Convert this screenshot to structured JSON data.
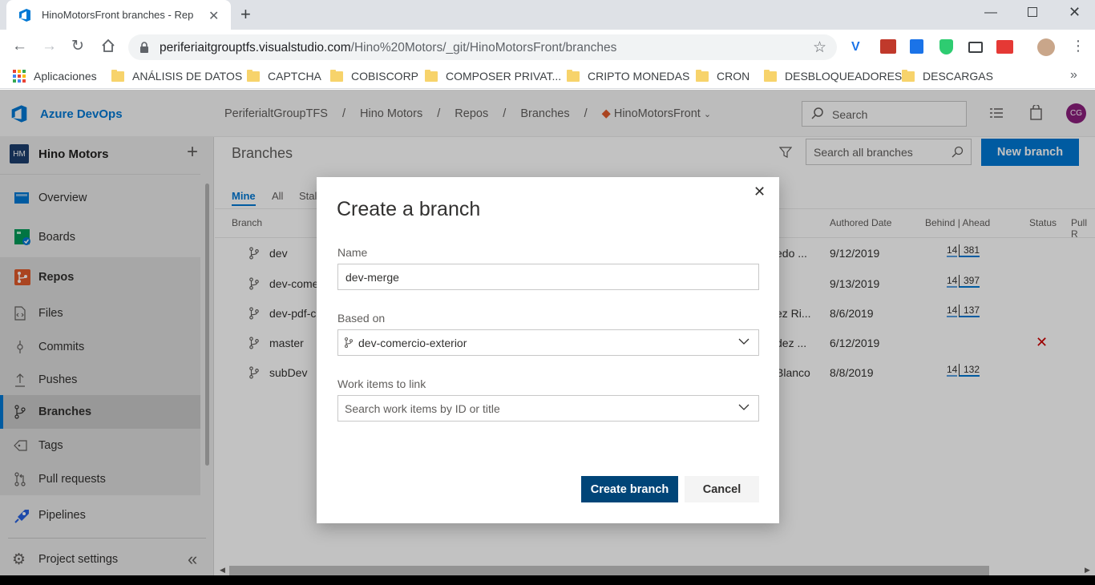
{
  "browser": {
    "tab_title": "HinoMotorsFront branches - Rep",
    "url_host": "periferiaitgrouptfs.visualstudio.com",
    "url_path": "/Hino%20Motors/_git/HinoMotorsFront/branches",
    "bookmarks": [
      "Aplicaciones",
      "ANÁLISIS DE DATOS",
      "CAPTCHA",
      "COBISCORP",
      "COMPOSER PRIVAT...",
      "CRIPTO MONEDAS",
      "CRON",
      "DESBLOQUEADORES",
      "DESCARGAS"
    ]
  },
  "ado": {
    "brand": "Azure DevOps",
    "breadcrumb": [
      "PeriferialtGroupTFS",
      "Hino Motors",
      "Repos",
      "Branches",
      "HinoMotorsFront"
    ],
    "search_placeholder": "Search",
    "avatar_initials": "CG",
    "project_badge": "HM",
    "project_name": "Hino Motors",
    "nav": {
      "overview": "Overview",
      "boards": "Boards",
      "repos": "Repos",
      "files": "Files",
      "commits": "Commits",
      "pushes": "Pushes",
      "branches": "Branches",
      "tags": "Tags",
      "pull_requests": "Pull requests",
      "pipelines": "Pipelines",
      "project_settings": "Project settings"
    }
  },
  "page": {
    "title": "Branches",
    "search_placeholder": "Search all branches",
    "new_branch": "New branch",
    "tabs": [
      "Mine",
      "All",
      "Stale"
    ],
    "columns": {
      "branch": "Branch",
      "authored_date": "Authored Date",
      "behind_ahead": "Behind | Ahead",
      "status": "Status",
      "pull": "Pull R"
    },
    "rows": [
      {
        "name": "dev",
        "author_partial": "edo ...",
        "date": "9/12/2019",
        "behind": "14",
        "ahead": "381"
      },
      {
        "name": "dev-come",
        "author_partial": "",
        "date": "9/13/2019",
        "behind": "14",
        "ahead": "397"
      },
      {
        "name": "dev-pdf-c",
        "author_partial": "ez Ri...",
        "date": "8/6/2019",
        "behind": "14",
        "ahead": "137"
      },
      {
        "name": "master",
        "author_partial": "dez ...",
        "date": "6/12/2019",
        "behind": "",
        "ahead": ""
      },
      {
        "name": "subDev",
        "author_partial": "Blanco",
        "date": "8/8/2019",
        "behind": "14",
        "ahead": "132"
      }
    ]
  },
  "dialog": {
    "title": "Create a branch",
    "name_label": "Name",
    "name_value": "dev-merge",
    "based_on_label": "Based on",
    "based_on_value": "dev-comercio-exterior",
    "work_items_label": "Work items to link",
    "work_items_placeholder": "Search work items by ID or title",
    "create_button": "Create branch",
    "cancel_button": "Cancel"
  },
  "colors": {
    "accent": "#0078d4",
    "primary_button": "#004578",
    "repos": "#e05a2b",
    "error": "#cd0000"
  }
}
